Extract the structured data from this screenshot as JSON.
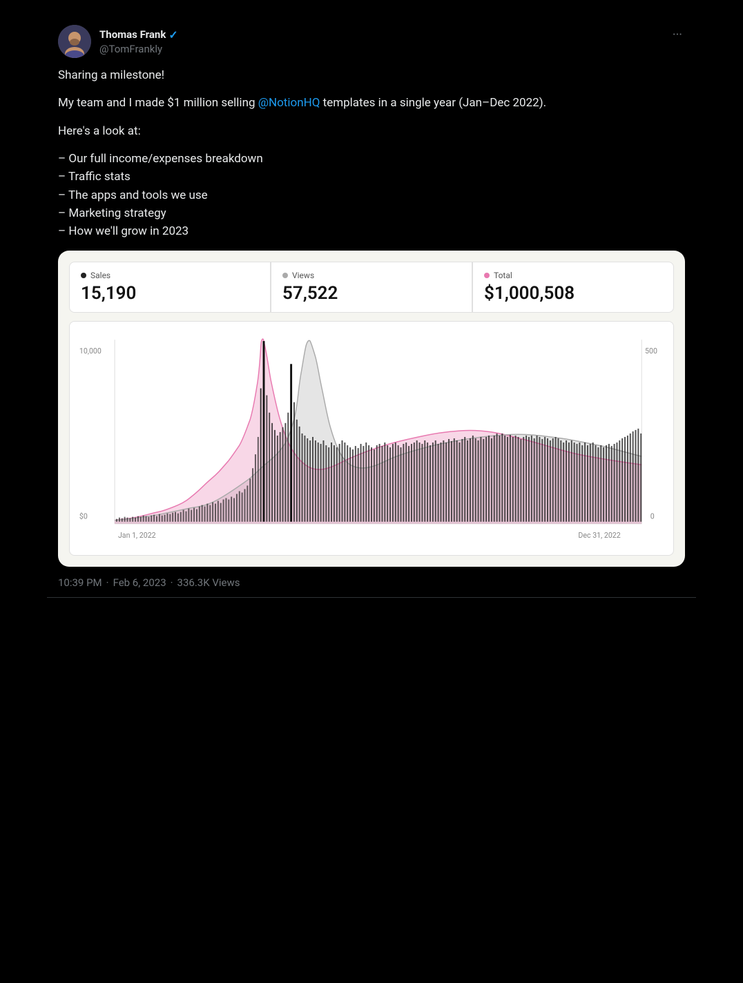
{
  "tweet": {
    "author": {
      "display_name": "Thomas Frank",
      "username": "@TomFrankly",
      "verified": true
    },
    "more_label": "···",
    "body": {
      "line1": "Sharing a milestone!",
      "line2_pre": "My team and I made $1 million selling ",
      "line2_mention": "@NotionHQ",
      "line2_post": " templates in a single year (Jan–Dec 2022).",
      "line3": "Here's a look at:",
      "list": [
        "– Our full income/expenses breakdown",
        "– Traffic stats",
        "– The apps and tools we use",
        "– Marketing strategy",
        "– How we'll grow in 2023"
      ]
    },
    "stats": [
      {
        "label": "Sales",
        "dot": "black",
        "value": "15,190"
      },
      {
        "label": "Views",
        "dot": "gray",
        "value": "57,522"
      },
      {
        "label": "Total",
        "dot": "pink",
        "value": "$1,000,508"
      }
    ],
    "chart": {
      "y_left_label": "10,000",
      "y_right_label": "500",
      "y_left_bottom": "$0",
      "y_right_bottom": "0",
      "x_left_label": "Jan 1, 2022",
      "x_right_label": "Dec 31, 2022"
    },
    "footer": {
      "time": "10:39 PM",
      "date": "Feb 6, 2023",
      "views": "336.3K Views"
    }
  }
}
